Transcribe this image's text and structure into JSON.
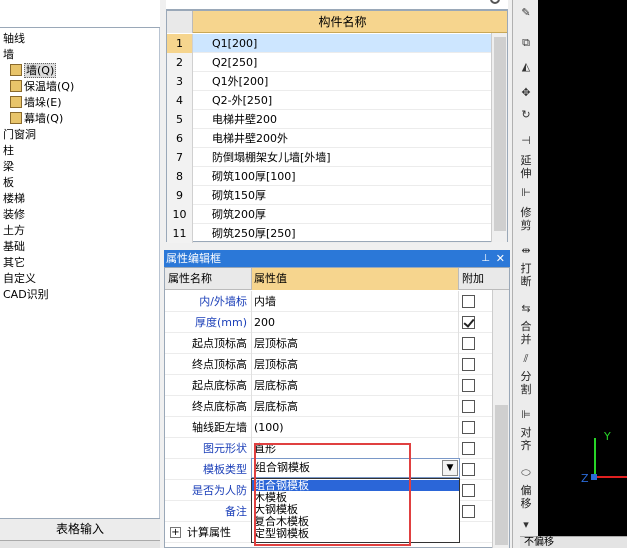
{
  "tree": {
    "items": [
      {
        "label": "轴线",
        "indent": 0,
        "icon": false
      },
      {
        "label": "墙",
        "indent": 0,
        "icon": false
      },
      {
        "label": "墙(Q)",
        "indent": 1,
        "icon": true,
        "selected": true
      },
      {
        "label": "保温墙(Q)",
        "indent": 1,
        "icon": true
      },
      {
        "label": "墙垛(E)",
        "indent": 1,
        "icon": true
      },
      {
        "label": "幕墙(Q)",
        "indent": 1,
        "icon": true
      },
      {
        "label": "门窗洞",
        "indent": 0,
        "icon": false
      },
      {
        "label": "柱",
        "indent": 0,
        "icon": false
      },
      {
        "label": "梁",
        "indent": 0,
        "icon": false
      },
      {
        "label": "板",
        "indent": 0,
        "icon": false
      },
      {
        "label": "楼梯",
        "indent": 0,
        "icon": false
      },
      {
        "label": "装修",
        "indent": 0,
        "icon": false
      },
      {
        "label": "土方",
        "indent": 0,
        "icon": false
      },
      {
        "label": "基础",
        "indent": 0,
        "icon": false
      },
      {
        "label": "其它",
        "indent": 0,
        "icon": false
      },
      {
        "label": "自定义",
        "indent": 0,
        "icon": false
      },
      {
        "label": "CAD识别",
        "indent": 0,
        "icon": false
      }
    ],
    "table_input_label": "表格输入"
  },
  "component_list": {
    "header": "构件名称",
    "rows": [
      {
        "num": "1",
        "name": "Q1[200]",
        "selected": true
      },
      {
        "num": "2",
        "name": "Q2[250]"
      },
      {
        "num": "3",
        "name": "Q1外[200]"
      },
      {
        "num": "4",
        "name": "Q2-外[250]"
      },
      {
        "num": "5",
        "name": "电梯井壁200"
      },
      {
        "num": "6",
        "name": "电梯井壁200外"
      },
      {
        "num": "7",
        "name": "防倒塌棚架女儿墙[外墙]"
      },
      {
        "num": "8",
        "name": "砌筑100厚[100]"
      },
      {
        "num": "9",
        "name": "砌筑150厚"
      },
      {
        "num": "10",
        "name": "砌筑200厚"
      },
      {
        "num": "11",
        "name": "砌筑250厚[250]"
      }
    ]
  },
  "property_panel": {
    "title": "属性编辑框",
    "pin": "⊥",
    "close": "✕",
    "col_name": "属性名称",
    "col_value": "属性值",
    "col_extra": "附加",
    "rows": [
      {
        "name": "内/外墙标",
        "value": "内墙",
        "blue": true,
        "checked": false
      },
      {
        "name": "厚度(mm)",
        "value": "200",
        "blue": true,
        "checked": true
      },
      {
        "name": "起点顶标高",
        "value": "层顶标高",
        "blue": false,
        "checked": false
      },
      {
        "name": "终点顶标高",
        "value": "层顶标高",
        "blue": false,
        "checked": false
      },
      {
        "name": "起点底标高",
        "value": "层底标高",
        "blue": false,
        "checked": false
      },
      {
        "name": "终点底标高",
        "value": "层底标高",
        "blue": false,
        "checked": false
      },
      {
        "name": "轴线距左墙",
        "value": "(100)",
        "blue": false,
        "checked": false
      },
      {
        "name": "图元形状",
        "value": "直形",
        "blue": true,
        "checked": false
      },
      {
        "name": "模板类型",
        "value": "",
        "blue": true,
        "checked": false
      },
      {
        "name": "是否为人防",
        "value": "",
        "blue": true,
        "checked": false
      },
      {
        "name": "备注",
        "value": "",
        "blue": true,
        "checked": false
      }
    ],
    "group1": "计算属性",
    "group1_sign": "+"
  },
  "formwork_combo": {
    "selected": "组合钢模板",
    "options": [
      "组合钢模板",
      "木模板",
      "大钢模板",
      "复合木模板",
      "定型钢模板"
    ]
  },
  "toolbar_right": {
    "extend": "延伸",
    "trim": "修剪",
    "break": "打断",
    "merge": "合并",
    "split": "分割",
    "align": "对齐",
    "offset": "偏移"
  },
  "canvas": {
    "y_axis": "Y",
    "z_axis": "Z"
  },
  "status": {
    "text": "不偏移"
  }
}
